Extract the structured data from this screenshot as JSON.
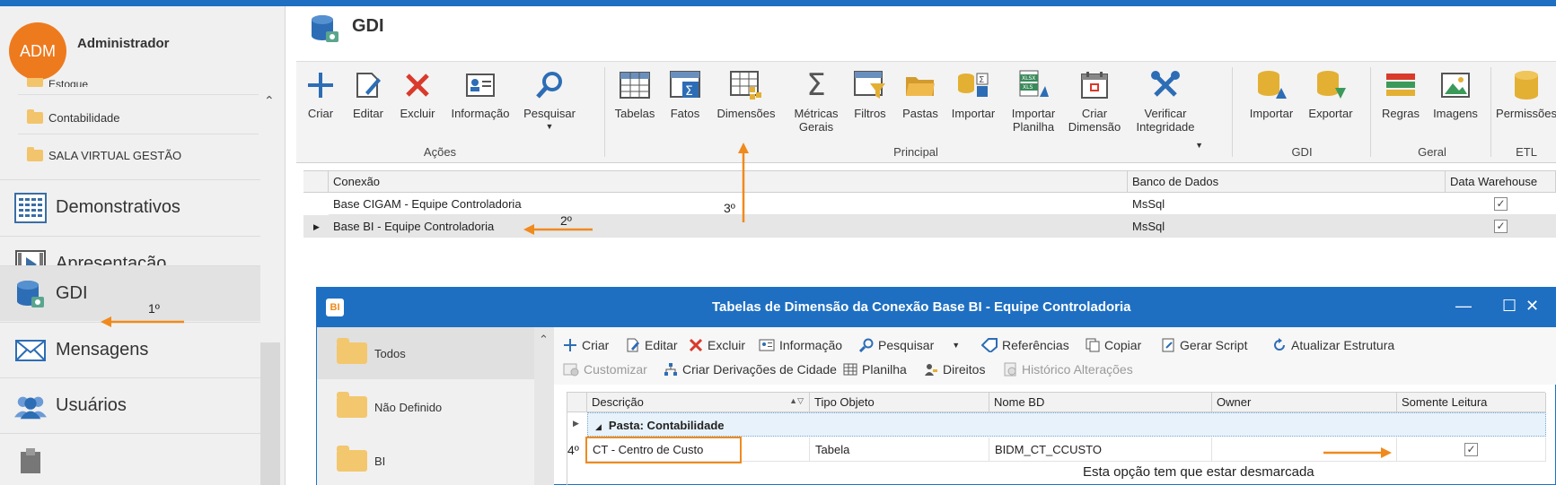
{
  "sidebar": {
    "avatar_initials": "ADM",
    "user_name": "Administrador",
    "partial_item": "Estoque",
    "tree_items": [
      {
        "label": "Contabilidade"
      },
      {
        "label": "SALA VIRTUAL GESTÃO"
      }
    ],
    "nav": [
      {
        "label": "Demonstrativos",
        "icon": "grid-report-icon"
      },
      {
        "label": "Apresentação",
        "icon": "presentation-icon"
      },
      {
        "label": "GDI",
        "icon": "database-icon"
      },
      {
        "label": "Mensagens",
        "icon": "envelope-icon"
      },
      {
        "label": "Usuários",
        "icon": "users-icon"
      }
    ]
  },
  "main": {
    "title": "GDI"
  },
  "ribbon": {
    "buttons": [
      {
        "label": "Criar"
      },
      {
        "label": "Editar"
      },
      {
        "label": "Excluir"
      },
      {
        "label": "Informação"
      },
      {
        "label": "Pesquisar"
      },
      {
        "label": "Tabelas"
      },
      {
        "label": "Fatos"
      },
      {
        "label": "Dimensões"
      },
      {
        "label": "Métricas Gerais"
      },
      {
        "label": "Filtros"
      },
      {
        "label": "Pastas"
      },
      {
        "label": "Importar"
      },
      {
        "label": "Importar Planilha"
      },
      {
        "label": "Criar Dimensão"
      },
      {
        "label": "Verificar Integridade"
      },
      {
        "label": "Importar"
      },
      {
        "label": "Exportar"
      },
      {
        "label": "Regras"
      },
      {
        "label": "Imagens"
      },
      {
        "label": "Permissões"
      }
    ],
    "groups": [
      {
        "label": "Ações"
      },
      {
        "label": "Principal"
      },
      {
        "label": "GDI"
      },
      {
        "label": "Geral"
      },
      {
        "label": "ETL"
      }
    ]
  },
  "connections": {
    "columns": [
      "Conexão",
      "Banco de Dados",
      "Data Warehouse"
    ],
    "rows": [
      {
        "conexao": "Base CIGAM - Equipe Controladoria",
        "banco": "MsSql",
        "dw": true
      },
      {
        "conexao": "Base BI - Equipe Controladoria",
        "banco": "MsSql",
        "dw": true
      }
    ]
  },
  "dialog": {
    "logo": "BI",
    "title": "Tabelas de Dimensão da Conexão Base BI - Equipe Controladoria",
    "folders": [
      {
        "label": "Todos"
      },
      {
        "label": "Não Definido"
      },
      {
        "label": "BI"
      }
    ],
    "toolbar_row1": [
      {
        "label": "Criar"
      },
      {
        "label": "Editar"
      },
      {
        "label": "Excluir"
      },
      {
        "label": "Informação"
      },
      {
        "label": "Pesquisar"
      },
      {
        "label": "Referências"
      },
      {
        "label": "Copiar"
      },
      {
        "label": "Gerar Script"
      },
      {
        "label": "Atualizar Estrutura"
      }
    ],
    "toolbar_row2": [
      {
        "label": "Customizar"
      },
      {
        "label": "Criar Derivações de Cidade"
      },
      {
        "label": "Planilha"
      },
      {
        "label": "Direitos"
      },
      {
        "label": "Histórico Alterações"
      }
    ],
    "columns": [
      "Descrição",
      "Tipo Objeto",
      "Nome BD",
      "Owner",
      "Somente Leitura"
    ],
    "group_label": "Pasta: Contabilidade",
    "row": {
      "descricao": "CT - Centro de Custo",
      "tipo": "Tabela",
      "nome_bd": "BIDM_CT_CCUSTO",
      "owner": "",
      "somente_leitura": true
    }
  },
  "annotations": {
    "step1": "1º",
    "step2": "2º",
    "step3": "3º",
    "step4": "4º",
    "note": "Esta opção tem que estar desmarcada",
    "color": "#f08a1c"
  }
}
